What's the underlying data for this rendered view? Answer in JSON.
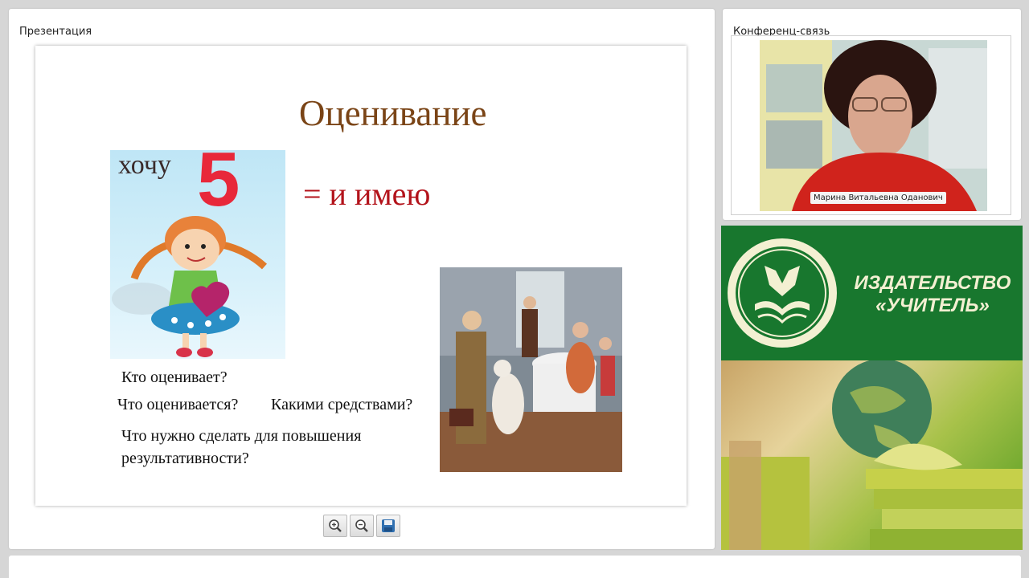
{
  "presentation": {
    "panel_title": "Презентация",
    "slide": {
      "title": "Оценивание",
      "want": "хочу",
      "grade": "5",
      "equals_text": "= и имею",
      "questions": [
        "Кто оценивает?",
        "Что оценивается?",
        "Какими средствами?",
        "Что нужно сделать для повышения",
        "результативности?"
      ]
    },
    "toolbar": {
      "zoom_in_icon": "zoom-in-icon",
      "zoom_out_icon": "zoom-out-icon",
      "save_icon": "save-icon"
    }
  },
  "conference": {
    "panel_title": "Конференц-связь",
    "speaker_name": "Марина Витальевна Оданович"
  },
  "banner": {
    "publisher_line1": "ИЗДАТЕЛЬСТВО",
    "publisher_line2": "«УЧИТЕЛЬ»",
    "colors": {
      "green": "#18772e",
      "cream": "#f3f0d2"
    }
  }
}
